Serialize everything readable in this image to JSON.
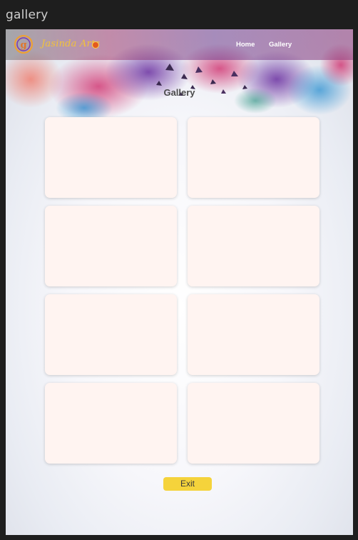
{
  "window": {
    "title": "gallery"
  },
  "header": {
    "brand_name": "Jasinda Arts",
    "nav": [
      {
        "label": "Home"
      },
      {
        "label": "Gallery"
      }
    ]
  },
  "main": {
    "heading": "Gallery",
    "cards_count_note": "",
    "exit_label": "Exit"
  },
  "colors": {
    "card_bg": "#fff4f1",
    "exit_button": "#f5d33b",
    "brand_text": "#f2c23a",
    "heading_text": "#4b4b4b"
  }
}
